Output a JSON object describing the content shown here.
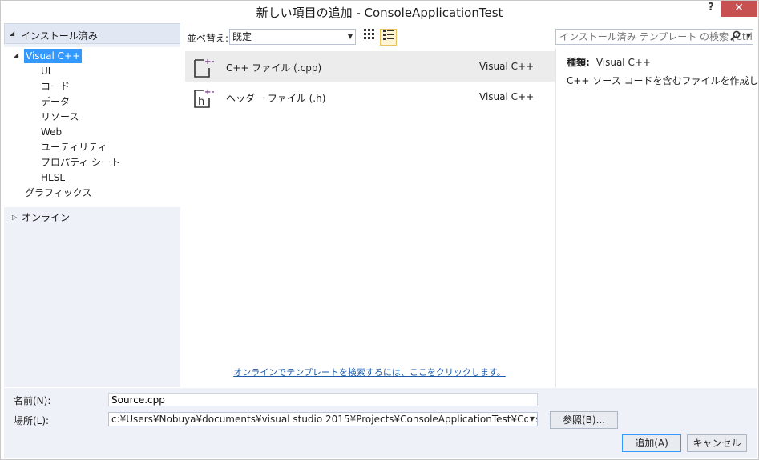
{
  "window": {
    "title": "新しい項目の追加 - ConsoleApplicationTest",
    "help_label": "?",
    "close_label": "✕"
  },
  "left": {
    "header": "インストール済み",
    "tree": {
      "root": "Visual C++",
      "children": [
        "UI",
        "コード",
        "データ",
        "リソース",
        "Web",
        "ユーティリティ",
        "プロパティ シート",
        "HLSL"
      ],
      "sibling": "グラフィックス"
    },
    "online": "オンライン"
  },
  "toolbar": {
    "sort_label": "並べ替え:",
    "sort_value": "既定",
    "search_placeholder": "インストール済み テンプレート の検索 (Ctrl+E)"
  },
  "templates": [
    {
      "name": "C++ ファイル (.cpp)",
      "lang": "Visual C++",
      "icon": "cpp-file-icon"
    },
    {
      "name": "ヘッダー ファイル (.h)",
      "lang": "Visual C++",
      "icon": "header-file-icon"
    }
  ],
  "online_link": "オンラインでテンプレートを検索するには、ここをクリックします。",
  "info": {
    "type_label": "種類:",
    "type_value": "Visual C++",
    "description": "C++ ソース コードを含むファイルを作成します。"
  },
  "bottom": {
    "name_label": "名前(N):",
    "name_value": "Source.cpp",
    "location_label": "場所(L):",
    "location_value": "c:¥Users¥Nobuya¥documents¥visual studio 2015¥Projects¥ConsoleApplicationTest¥Conso",
    "browse_label": "参照(B)...",
    "add_label": "追加(A)",
    "cancel_label": "キャンセル"
  },
  "colors": {
    "accent": "#3399ff",
    "close": "#c75050",
    "link": "#1e5aa8",
    "icon_purple": "#68217a"
  }
}
